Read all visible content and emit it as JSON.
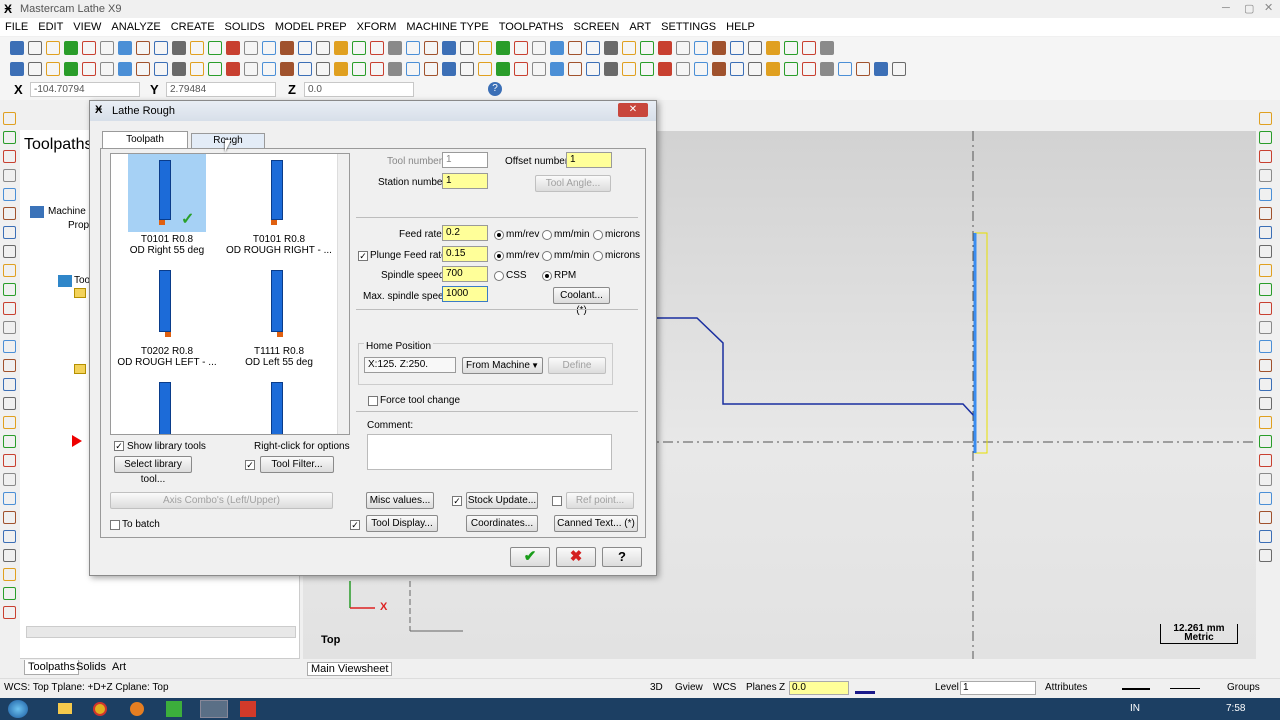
{
  "app": {
    "title": "Mastercam Lathe X9"
  },
  "menu": [
    "FILE",
    "EDIT",
    "VIEW",
    "ANALYZE",
    "CREATE",
    "SOLIDS",
    "MODEL PREP",
    "XFORM",
    "MACHINE TYPE",
    "TOOLPATHS",
    "SCREEN",
    "ART",
    "SETTINGS",
    "HELP"
  ],
  "coords": {
    "x_label": "X",
    "x_value": "-104.70794",
    "y_label": "Y",
    "y_value": "2.79484",
    "z_label": "Z",
    "z_value": "0.0"
  },
  "panel": {
    "title": "Toolpaths",
    "tree": {
      "machine": "Machine",
      "props": "Prop",
      "toolpaths": "Tool"
    },
    "tabs": [
      "Toolpaths",
      "Solids",
      "Art"
    ]
  },
  "viewport": {
    "view_name": "Top",
    "tab": "Main Viewsheet",
    "axis_x": "X",
    "scale_value": "12.261 mm",
    "scale_unit": "Metric"
  },
  "status": {
    "wcs": "WCS: Top  Tplane: +D+Z  Cplane: Top",
    "buttons": [
      "3D",
      "Gview",
      "WCS",
      "Planes"
    ],
    "z_label": "Z",
    "z_value": "0.0",
    "level_label": "Level",
    "level_value": "1",
    "attributes": "Attributes",
    "groups": "Groups"
  },
  "taskbar": {
    "lang": "IN",
    "time": "7:58"
  },
  "dialog": {
    "title": "Lathe Rough",
    "tabs": [
      "Toolpath parameters",
      "Rough parameters"
    ],
    "tools": [
      {
        "code": "T0101 R0.8",
        "name": "OD Right 55 deg"
      },
      {
        "code": "T0101 R0.8",
        "name": "OD ROUGH RIGHT - ..."
      },
      {
        "code": "T0202 R0.8",
        "name": "OD ROUGH LEFT - ..."
      },
      {
        "code": "T1111 R0.8",
        "name": "OD Left 55 deg"
      }
    ],
    "show_library": "Show library tools",
    "right_click": "Right-click for options",
    "select_library": "Select library tool...",
    "tool_filter": "Tool Filter...",
    "tool_number_label": "Tool number",
    "tool_number": "1",
    "offset_label": "Offset number",
    "offset": "1",
    "station_label": "Station number",
    "station": "1",
    "tool_angle": "Tool Angle...",
    "feed_label": "Feed rate",
    "feed": "0.2",
    "plunge_label": "Plunge Feed rate",
    "plunge": "0.15",
    "spindle_label": "Spindle speed",
    "spindle": "700",
    "max_spindle_label": "Max. spindle speed",
    "max_spindle": "1000",
    "units": {
      "mmrev": "mm/rev",
      "mmmin": "mm/min",
      "microns": "microns",
      "css": "CSS",
      "rpm": "RPM"
    },
    "coolant": "Coolant... (*)",
    "home_title": "Home Position",
    "home_value": "X:125.  Z:250.",
    "from_machine": "From Machine",
    "define": "Define",
    "force_tool": "Force tool change",
    "comment": "Comment:",
    "axis_combo": "Axis Combo's (Left/Upper)",
    "misc": "Misc values...",
    "stock_update": "Stock Update...",
    "ref_point": "Ref point...",
    "to_batch": "To batch",
    "tool_display": "Tool Display...",
    "coordinates": "Coordinates...",
    "canned_text": "Canned Text... (*)",
    "colors": {
      "highlight": "#a6d1f5",
      "yellow": "#ffff99",
      "ok": "#1a9d1a",
      "cancel": "#d42020"
    }
  }
}
